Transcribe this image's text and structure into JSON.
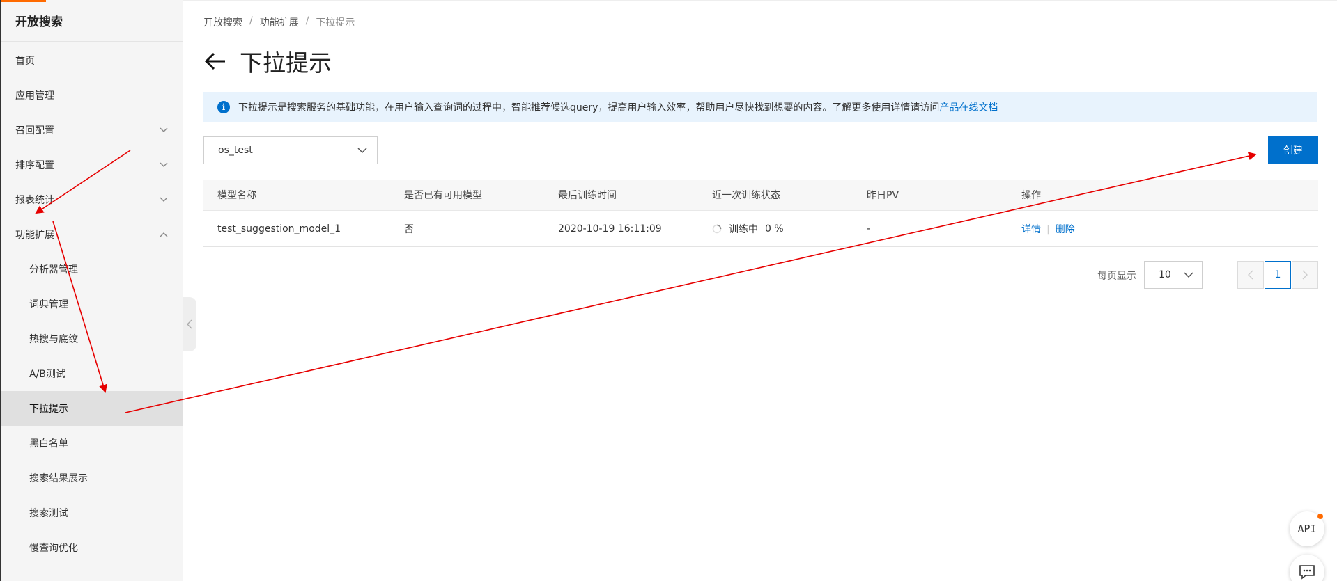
{
  "sidebar": {
    "title": "开放搜索",
    "items": [
      {
        "label": "首页",
        "expandable": false,
        "sub": false
      },
      {
        "label": "应用管理",
        "expandable": false,
        "sub": false
      },
      {
        "label": "召回配置",
        "expandable": true,
        "expanded": false,
        "sub": false
      },
      {
        "label": "排序配置",
        "expandable": true,
        "expanded": false,
        "sub": false
      },
      {
        "label": "报表统计",
        "expandable": true,
        "expanded": false,
        "sub": false
      },
      {
        "label": "功能扩展",
        "expandable": true,
        "expanded": true,
        "sub": false
      },
      {
        "label": "分析器管理",
        "sub": true
      },
      {
        "label": "词典管理",
        "sub": true
      },
      {
        "label": "热搜与底纹",
        "sub": true
      },
      {
        "label": "A/B测试",
        "sub": true
      },
      {
        "label": "下拉提示",
        "sub": true,
        "active": true
      },
      {
        "label": "黑白名单",
        "sub": true
      },
      {
        "label": "搜索结果展示",
        "sub": true
      },
      {
        "label": "搜索测试",
        "sub": true
      },
      {
        "label": "慢查询优化",
        "sub": true
      }
    ]
  },
  "breadcrumb": {
    "items": [
      "开放搜索",
      "功能扩展",
      "下拉提示"
    ],
    "separator": "/"
  },
  "page": {
    "title": "下拉提示"
  },
  "notice": {
    "text": "下拉提示是搜索服务的基础功能，在用户输入查询词的过程中，智能推荐候选query，提高用户输入效率，帮助用户尽快找到想要的内容。了解更多使用详情请访问",
    "link_text": "产品在线文档"
  },
  "app_select": {
    "value": "os_test"
  },
  "toolbar": {
    "create_label": "创建"
  },
  "table": {
    "headers": [
      "模型名称",
      "是否已有可用模型",
      "最后训练时间",
      "近一次训练状态",
      "昨日PV",
      "操作"
    ],
    "rows": [
      {
        "name": "test_suggestion_model_1",
        "available": "否",
        "last_trained": "2020-10-19 16:11:09",
        "status": "训练中",
        "progress": "0 %",
        "pv": "-",
        "actions": [
          "详情",
          "删除"
        ]
      }
    ]
  },
  "pagination": {
    "per_page_label": "每页显示",
    "per_page_value": "10",
    "current_page": "1"
  },
  "floating": {
    "api_label": "API"
  },
  "colors": {
    "primary": "#0070cc",
    "accent": "#ff6a00",
    "annotation": "#e60000",
    "notice_bg": "#e8f3fd",
    "sidebar_bg": "#f5f5f5"
  },
  "icons": [
    "back-arrow-icon",
    "info-icon",
    "chevron-down-icon",
    "chevron-up-icon",
    "chevron-left-icon",
    "chevron-right-icon",
    "spinner-icon",
    "chat-icon"
  ]
}
